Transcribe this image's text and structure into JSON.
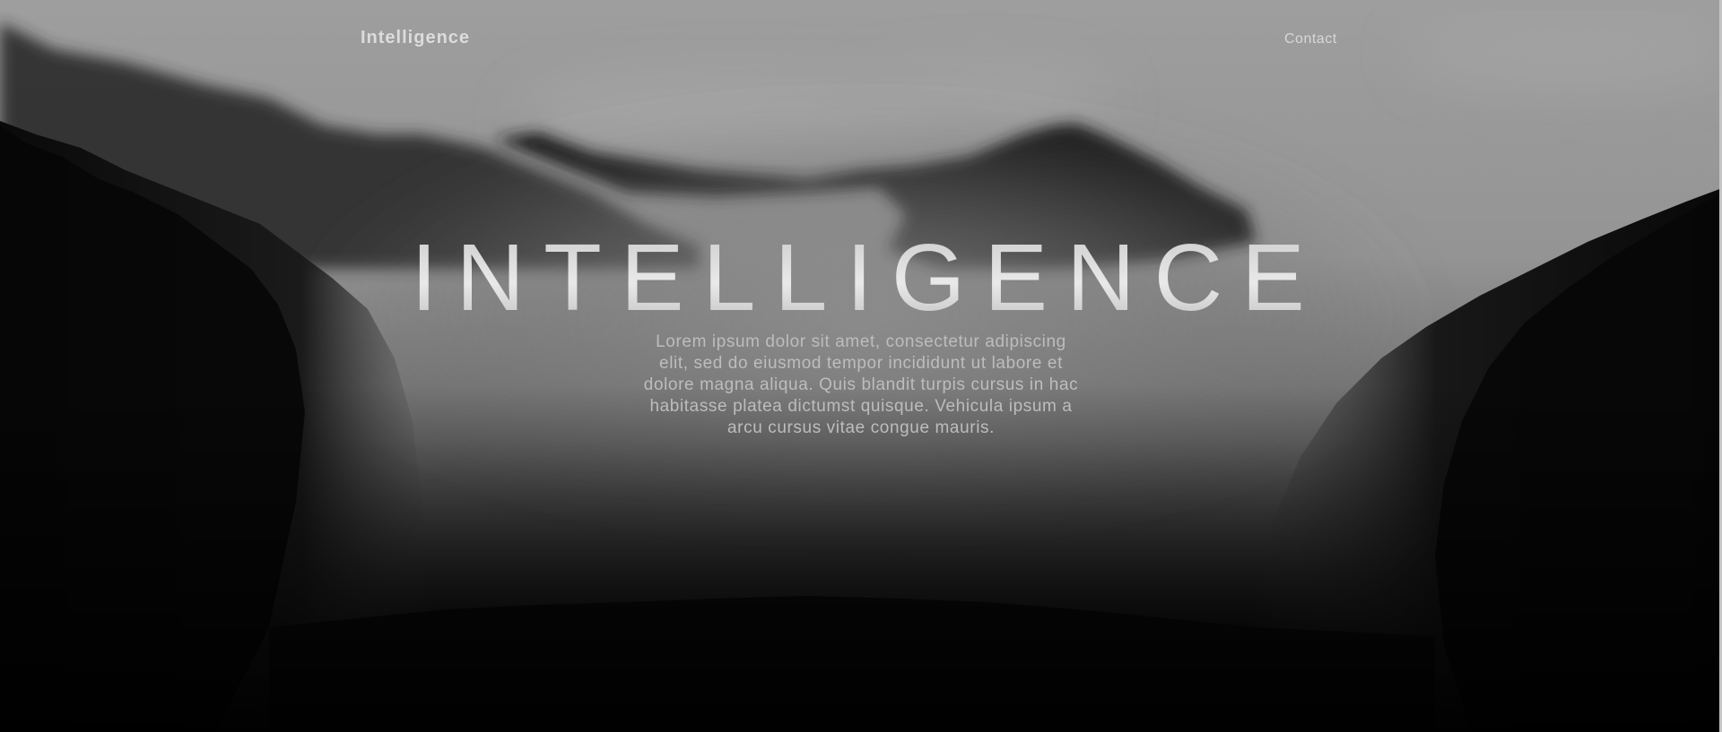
{
  "nav": {
    "brand": "Intelligence",
    "contact_label": "Contact"
  },
  "hero": {
    "title": "INTELLIGENCE",
    "description": "Lorem ipsum dolor sit amet, consectetur adipiscing elit, sed do eiusmod tempor incididunt ut labore et dolore magna aliqua. Quis blandit turpis cursus in hac habitasse platea dictumst quisque. Vehicula ipsum a arcu cursus vitae congue mauris."
  },
  "colors": {
    "sky": "#9c9c9c",
    "forest": "#050505",
    "text": "#d8d8d8"
  }
}
